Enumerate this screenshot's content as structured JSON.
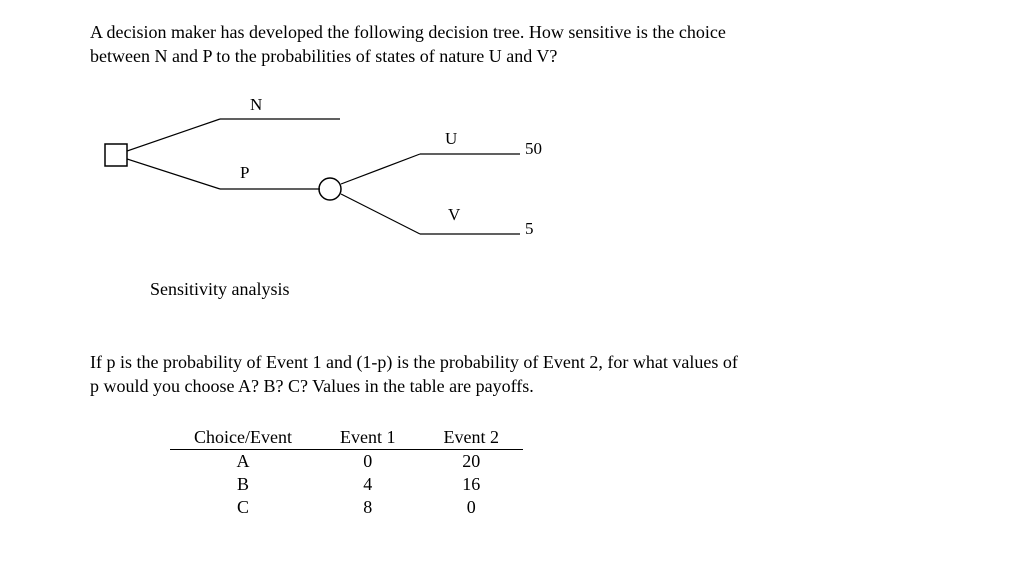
{
  "problem1": {
    "text_line1": "A decision maker has developed the following decision tree.  How sensitive is the choice",
    "text_line2": "between N and P to the probabilities of states of nature U and V?"
  },
  "tree": {
    "label_N": "N",
    "label_P": "P",
    "label_U": "U",
    "label_V": "V",
    "value_U": "50",
    "value_V": "5"
  },
  "heading": "Sensitivity analysis",
  "problem2": {
    "text_line1": "If p is the probability of Event 1 and (1-p) is the probability of Event 2, for what values of",
    "text_line2": "p would you choose A? B? C?  Values in the table are payoffs."
  },
  "table": {
    "headers": [
      "Choice/Event",
      "Event 1",
      "Event 2"
    ],
    "rows": [
      [
        "A",
        "0",
        "20"
      ],
      [
        "B",
        "4",
        "16"
      ],
      [
        "C",
        "8",
        "0"
      ]
    ]
  }
}
